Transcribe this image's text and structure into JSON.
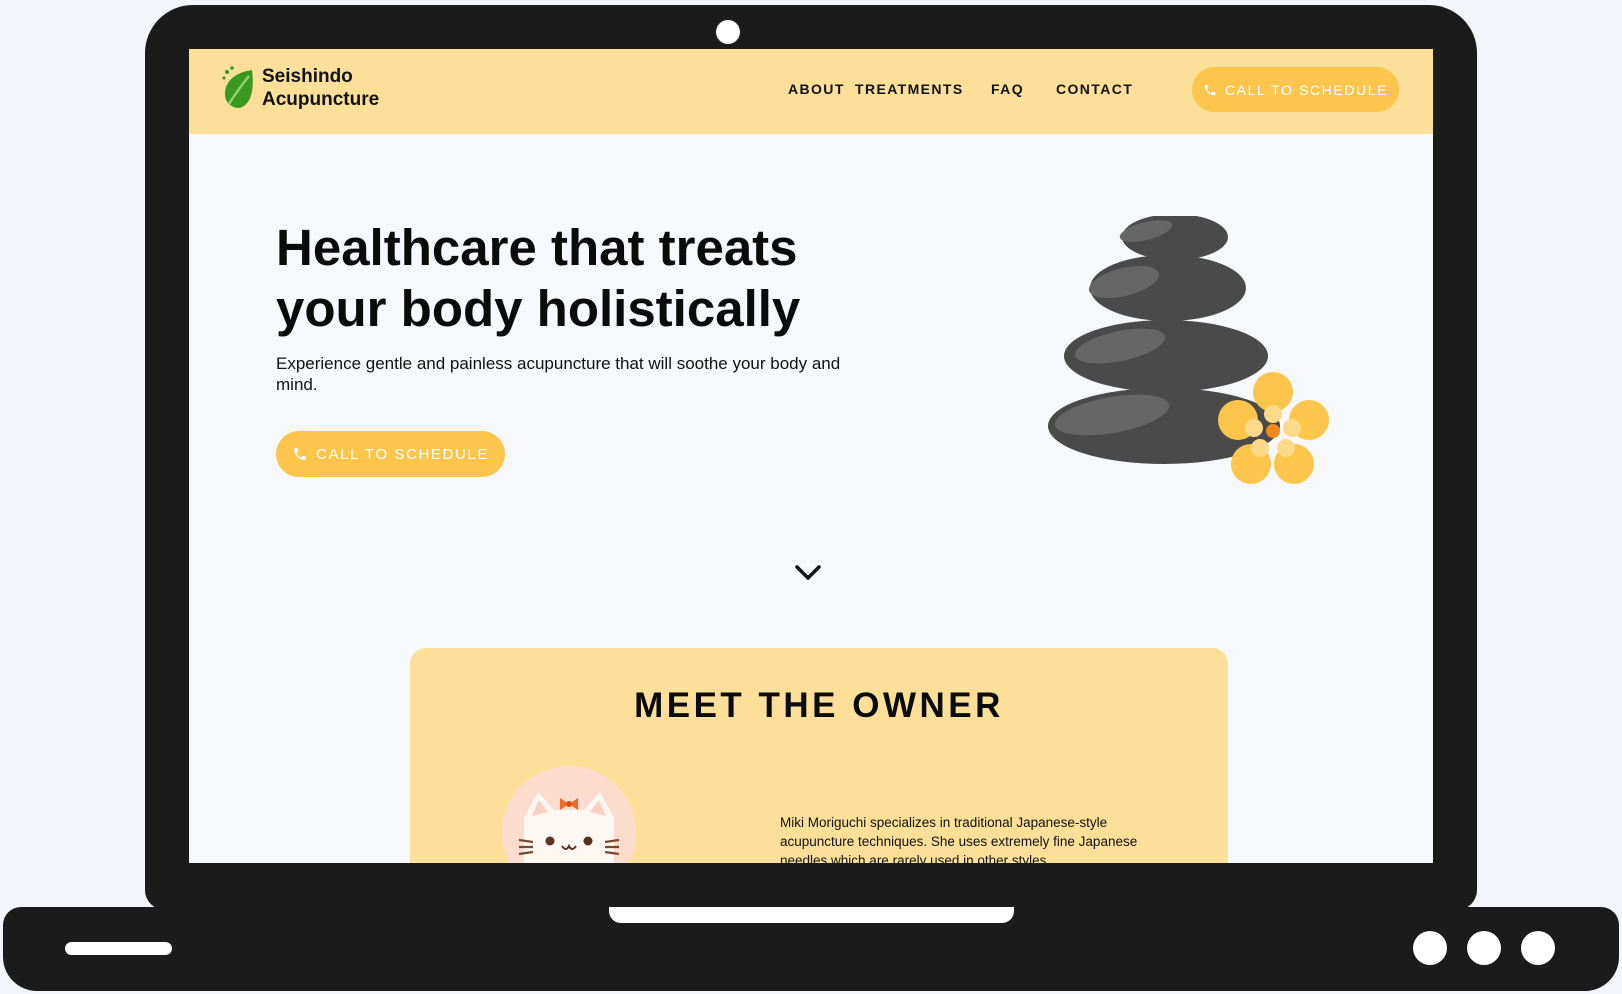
{
  "brand": {
    "line1": "Seishindo",
    "line2": "Acupuncture"
  },
  "nav": {
    "links": [
      {
        "label": "ABOUT"
      },
      {
        "label": "TREATMENTS"
      },
      {
        "label": "FAQ"
      },
      {
        "label": "CONTACT"
      }
    ],
    "cta_label": "CALL TO SCHEDULE"
  },
  "hero": {
    "title": "Healthcare that treats your body holistically",
    "subtitle": "Experience gentle and painless acupuncture that will soothe your body and mind.",
    "cta_label": "CALL TO SCHEDULE"
  },
  "owner": {
    "heading": "MEET THE OWNER",
    "bio": "Miki Moriguchi specializes in traditional Japanese-style acupuncture techniques. She uses extremely fine Japanese needles which are rarely used in other styles"
  },
  "icons": {
    "logo": "leaf-icon",
    "phone": "phone-icon",
    "scroll": "chevron-down-icon",
    "hero_image": "stacked-stones-with-flower",
    "avatar": "cat-avatar"
  },
  "colors": {
    "accent": "#fbc64b",
    "nav_bg": "#fcdf99",
    "card_bg": "#fcdf99",
    "page_bg": "#f7f8fc",
    "logo_green": "#3a9a1f",
    "stone": "#4a4a4a"
  }
}
